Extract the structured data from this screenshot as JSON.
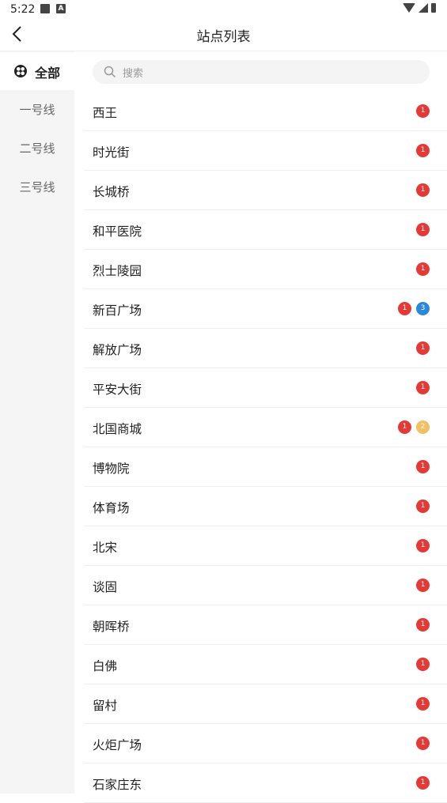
{
  "status_bar": {
    "time": "5:22",
    "notif_icons": [
      "image-icon",
      "a-icon"
    ],
    "right_icons": [
      "wifi-icon",
      "signal-icon",
      "battery-icon"
    ]
  },
  "header": {
    "title": "站点列表",
    "back_icon": "chevron-left-icon"
  },
  "sidebar": {
    "items": [
      {
        "label": "全部",
        "active": true,
        "icon": "clover-icon"
      },
      {
        "label": "一号线"
      },
      {
        "label": "二号线"
      },
      {
        "label": "三号线"
      }
    ]
  },
  "search": {
    "placeholder": "搜索",
    "icon": "search-icon"
  },
  "colors": {
    "red": "#e53935",
    "blue": "#1e88e5",
    "yellow": "#f2c063"
  },
  "stations": [
    {
      "name": "西王",
      "lines": [
        {
          "num": "1",
          "color": "#e53935"
        }
      ]
    },
    {
      "name": "时光街",
      "lines": [
        {
          "num": "1",
          "color": "#e53935"
        }
      ]
    },
    {
      "name": "长城桥",
      "lines": [
        {
          "num": "1",
          "color": "#e53935"
        }
      ]
    },
    {
      "name": "和平医院",
      "lines": [
        {
          "num": "1",
          "color": "#e53935"
        }
      ]
    },
    {
      "name": "烈士陵园",
      "lines": [
        {
          "num": "1",
          "color": "#e53935"
        }
      ]
    },
    {
      "name": "新百广场",
      "lines": [
        {
          "num": "1",
          "color": "#e53935"
        },
        {
          "num": "3",
          "color": "#2b88d8"
        }
      ]
    },
    {
      "name": "解放广场",
      "lines": [
        {
          "num": "1",
          "color": "#e53935"
        }
      ]
    },
    {
      "name": "平安大街",
      "lines": [
        {
          "num": "1",
          "color": "#e53935"
        }
      ]
    },
    {
      "name": "北国商城",
      "lines": [
        {
          "num": "1",
          "color": "#e53935"
        },
        {
          "num": "2",
          "color": "#f2c063"
        }
      ]
    },
    {
      "name": "博物院",
      "lines": [
        {
          "num": "1",
          "color": "#e53935"
        }
      ]
    },
    {
      "name": "体育场",
      "lines": [
        {
          "num": "1",
          "color": "#e53935"
        }
      ]
    },
    {
      "name": "北宋",
      "lines": [
        {
          "num": "1",
          "color": "#e53935"
        }
      ]
    },
    {
      "name": "谈固",
      "lines": [
        {
          "num": "1",
          "color": "#e53935"
        }
      ]
    },
    {
      "name": "朝晖桥",
      "lines": [
        {
          "num": "1",
          "color": "#e53935"
        }
      ]
    },
    {
      "name": "白佛",
      "lines": [
        {
          "num": "1",
          "color": "#e53935"
        }
      ]
    },
    {
      "name": "留村",
      "lines": [
        {
          "num": "1",
          "color": "#e53935"
        }
      ]
    },
    {
      "name": "火炬广场",
      "lines": [
        {
          "num": "1",
          "color": "#e53935"
        }
      ]
    },
    {
      "name": "石家庄东",
      "lines": [
        {
          "num": "1",
          "color": "#e53935"
        }
      ]
    }
  ]
}
